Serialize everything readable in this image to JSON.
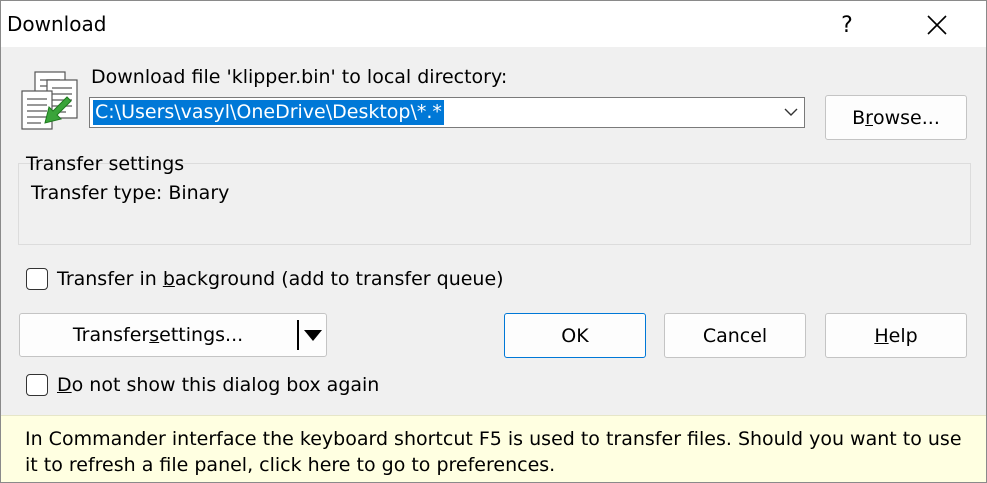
{
  "window": {
    "title": "Download",
    "help_glyph": "?",
    "close_icon": "close-icon"
  },
  "prompt_pre": "Download file '",
  "prompt_file": "klipper.bin",
  "prompt_post": "' to local directory:",
  "target_path": "C:\\Users\\vasyl\\OneDrive\\Desktop\\*.*",
  "browse_button": {
    "pre": "B",
    "key": "r",
    "post": "owse..."
  },
  "transfer_settings_group": {
    "label": "Transfer settings",
    "transfer_type": "Transfer type: Binary"
  },
  "background_checkbox": {
    "pre": "Transfer in ",
    "key": "b",
    "post": "ackground (add to transfer queue)",
    "checked": false
  },
  "transfer_settings_button": {
    "pre": "Transfer ",
    "key": "s",
    "post": "ettings..."
  },
  "ok_button": "OK",
  "cancel_button": "Cancel",
  "help_button": {
    "key": "H",
    "post": "elp"
  },
  "dont_show_checkbox": {
    "key": "D",
    "post": "o not show this dialog box again",
    "checked": false
  },
  "tip_text": "In Commander interface the keyboard shortcut F5 is used to transfer files. Should you want to use it to refresh a file panel, click here to go to preferences.",
  "colors": {
    "selection": "#0078d7",
    "tip_background": "#ffffe1",
    "arrow_green": "#3aa43a"
  }
}
